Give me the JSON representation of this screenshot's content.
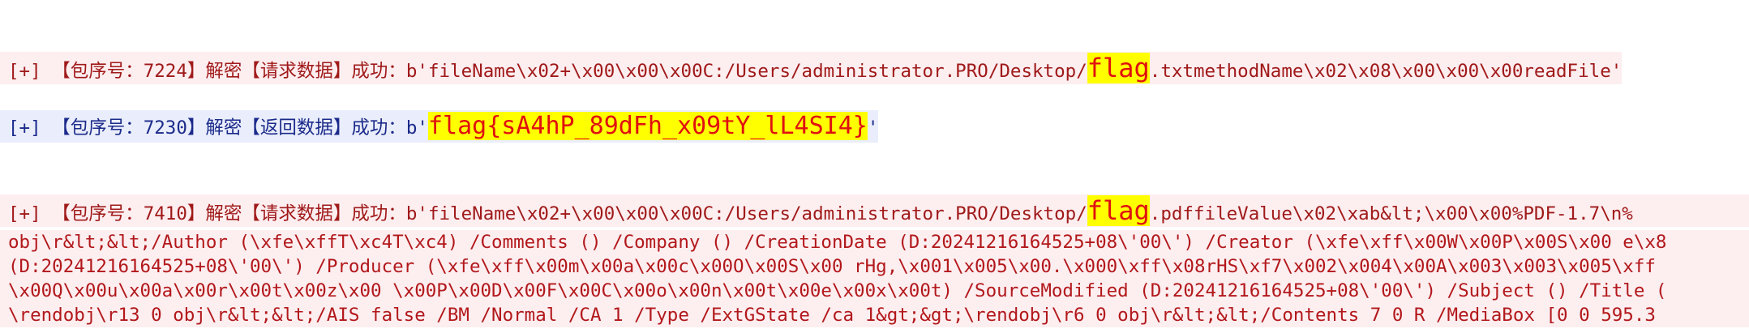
{
  "entries": [
    {
      "prefix": "[+] ",
      "head": "【包序号：7224】解密【请求数据】成功：b'fileName\\x02+\\x00\\x00\\x00C:/Users/administrator.PRO/Desktop/",
      "flag": "flag",
      "tail": ".txtmethodName\\x02\\x08\\x00\\x00\\x00readFile'"
    },
    {
      "prefix": "[+] ",
      "head": "【包序号：7230】解密【返回数据】成功：b'",
      "flag": "flag{sA4hP_89dFh_x09tY_lL4SI4}",
      "tail": "'"
    },
    {
      "prefix": "[+] ",
      "head": "【包序号：7410】解密【请求数据】成功：b'fileName\\x02+\\x00\\x00\\x00C:/Users/administrator.PRO/Desktop/",
      "flag": "flag",
      "tail": ".pdffileValue\\x02\\xab&lt;\\x00\\x00%PDF-1.7\\n%"
    }
  ],
  "continuation_lines": [
    "obj\\r&lt;&lt;/Author (\\xfe\\xffT\\xc4T\\xc4) /Comments () /Company () /CreationDate (D:20241216164525+08\\'00\\') /Creator (\\xfe\\xff\\x00W\\x00P\\x00S\\x00 e\\x8",
    "(D:20241216164525+08\\'00\\') /Producer (\\xfe\\xff\\x00m\\x00a\\x00c\\x00O\\x00S\\x00 rHg,\\x001\\x005\\x00.\\x000\\xff\\x08rHS\\xf7\\x002\\x004\\x00A\\x003\\x003\\x005\\xff",
    "\\x00Q\\x00u\\x00a\\x00r\\x00t\\x00z\\x00 \\x00P\\x00D\\x00F\\x00C\\x00o\\x00n\\x00t\\x00e\\x00x\\x00t) /SourceModified (D:20241216164525+08\\'00\\') /Subject () /Title (",
    "\\rendobj\\r13 0 obj\\r&lt;&lt;/AIS false /BM /Normal /CA 1 /Type /ExtGState /ca 1&gt;&gt;\\rendobj\\r6 0 obj\\r&lt;&lt;/Contents 7 0 R /MediaBox [0 0 595.3"
  ]
}
